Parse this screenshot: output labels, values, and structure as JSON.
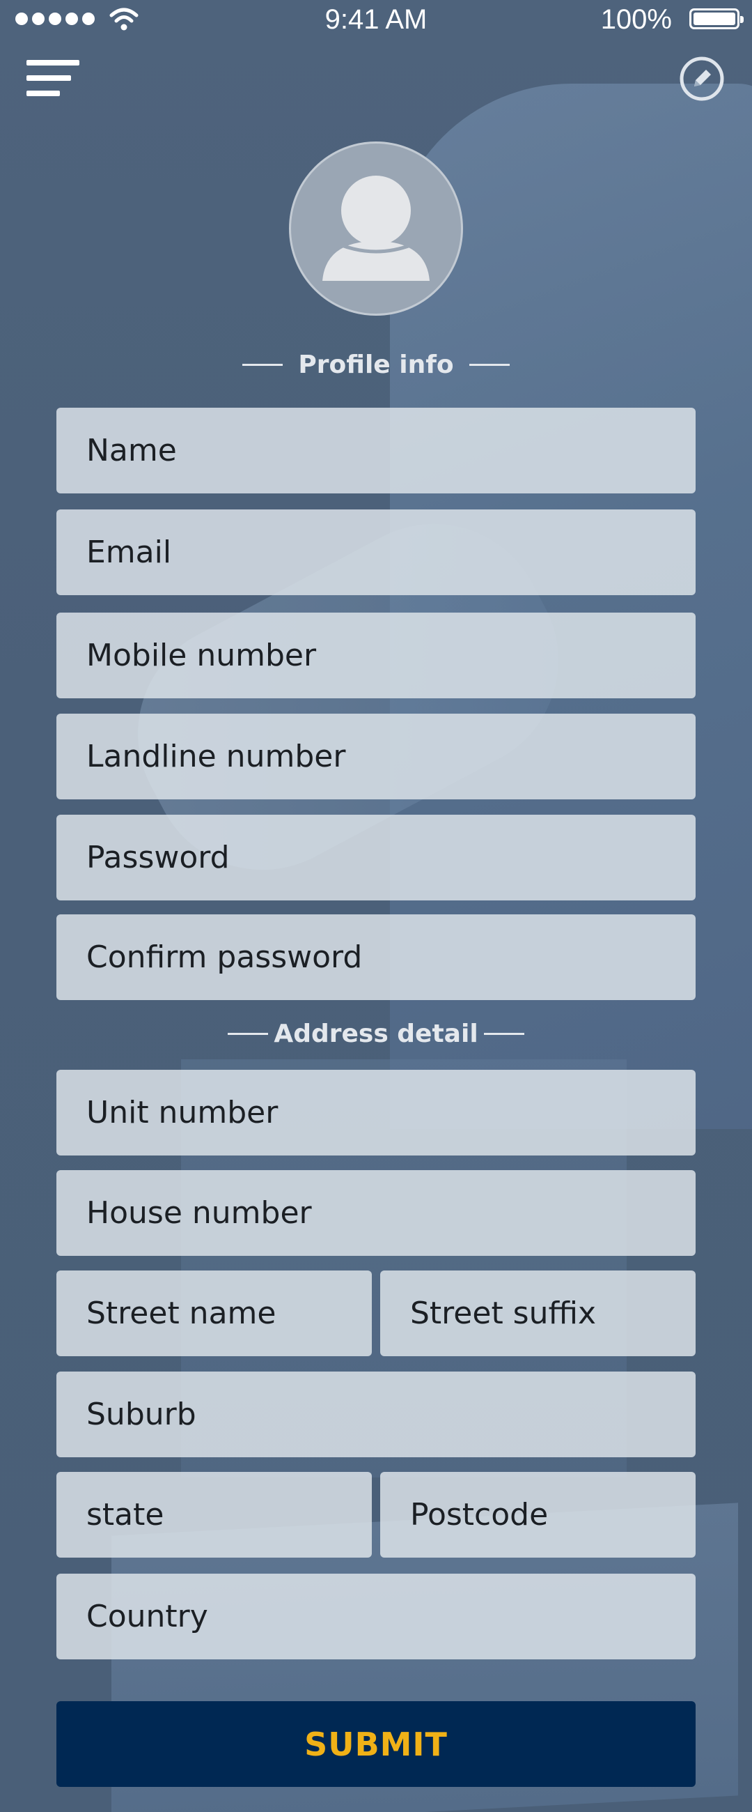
{
  "status_bar": {
    "time": "9:41 AM",
    "battery": "100%"
  },
  "icons": {
    "menu": "hamburger-menu-icon",
    "edit": "pencil-edit-icon",
    "avatar": "user-silhouette-icon"
  },
  "colors": {
    "submit_bg": "#002853",
    "submit_text": "#f0b117",
    "field_bg": "#dde3e9",
    "page_bg": "#4a6078"
  },
  "profile_section": {
    "title": "Profile info",
    "fields": {
      "name": "Name",
      "email": "Email",
      "mobile": "Mobile number",
      "landline": "Landline number",
      "password": "Password",
      "confirm_password": "Confirm password"
    }
  },
  "address_section": {
    "title": "Address detail",
    "fields": {
      "unit": "Unit number",
      "house": "House number",
      "street_name": "Street name",
      "street_suffix": "Street suffix",
      "suburb": "Suburb",
      "state": "state",
      "postcode": "Postcode",
      "country": "Country"
    }
  },
  "submit_label": "SUBMIT"
}
